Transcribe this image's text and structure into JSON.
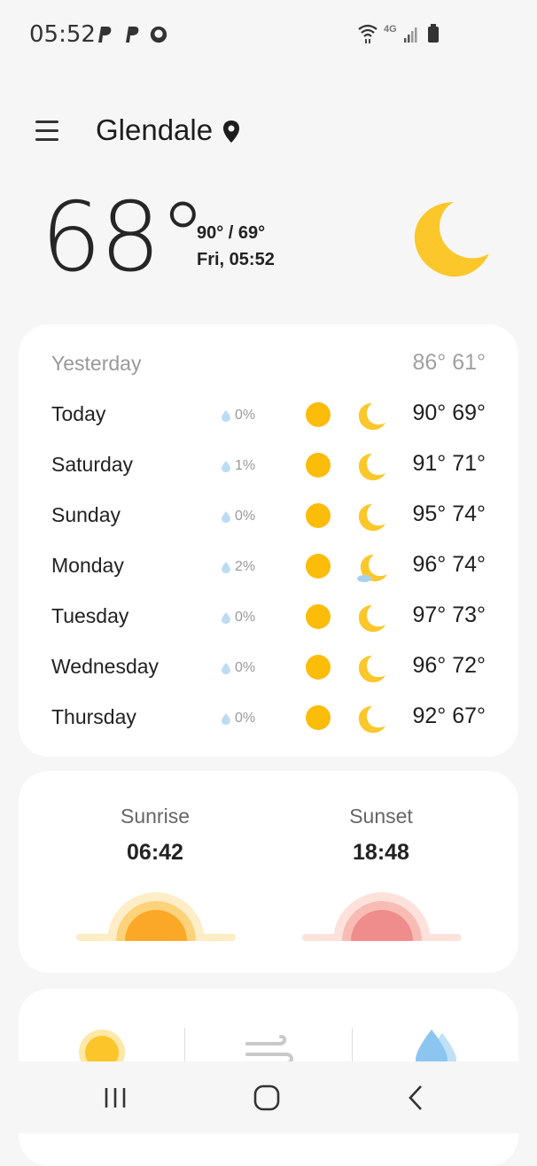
{
  "status_bar": {
    "time": "05:52",
    "network": "4G"
  },
  "header": {
    "location": "Glendale"
  },
  "current": {
    "temperature": "68°",
    "hi_lo": "90° / 69°",
    "date_time": "Fri, 05:52",
    "condition_icon": "moon-icon"
  },
  "forecast": {
    "yesterday": {
      "day": "Yesterday",
      "temps": "86° 61°"
    },
    "days": [
      {
        "day": "Today",
        "precip": "0%",
        "temps": "90° 69°",
        "night_icon": "moon-icon"
      },
      {
        "day": "Saturday",
        "precip": "1%",
        "temps": "91° 71°",
        "night_icon": "moon-icon"
      },
      {
        "day": "Sunday",
        "precip": "0%",
        "temps": "95° 74°",
        "night_icon": "moon-icon"
      },
      {
        "day": "Monday",
        "precip": "2%",
        "temps": "96° 74°",
        "night_icon": "moon-cloud-icon"
      },
      {
        "day": "Tuesday",
        "precip": "0%",
        "temps": "97° 73°",
        "night_icon": "moon-icon"
      },
      {
        "day": "Wednesday",
        "precip": "0%",
        "temps": "96° 72°",
        "night_icon": "moon-icon"
      },
      {
        "day": "Thursday",
        "precip": "0%",
        "temps": "92° 67°",
        "night_icon": "moon-icon"
      }
    ]
  },
  "sun": {
    "sunrise_label": "Sunrise",
    "sunrise_time": "06:42",
    "sunset_label": "Sunset",
    "sunset_time": "18:48"
  },
  "colors": {
    "sun": "#fcbc0a",
    "moon": "#fcc72a",
    "sunrise": "#fba828",
    "sunset": "#ef8c8c",
    "drop": "#bcdcf3"
  }
}
